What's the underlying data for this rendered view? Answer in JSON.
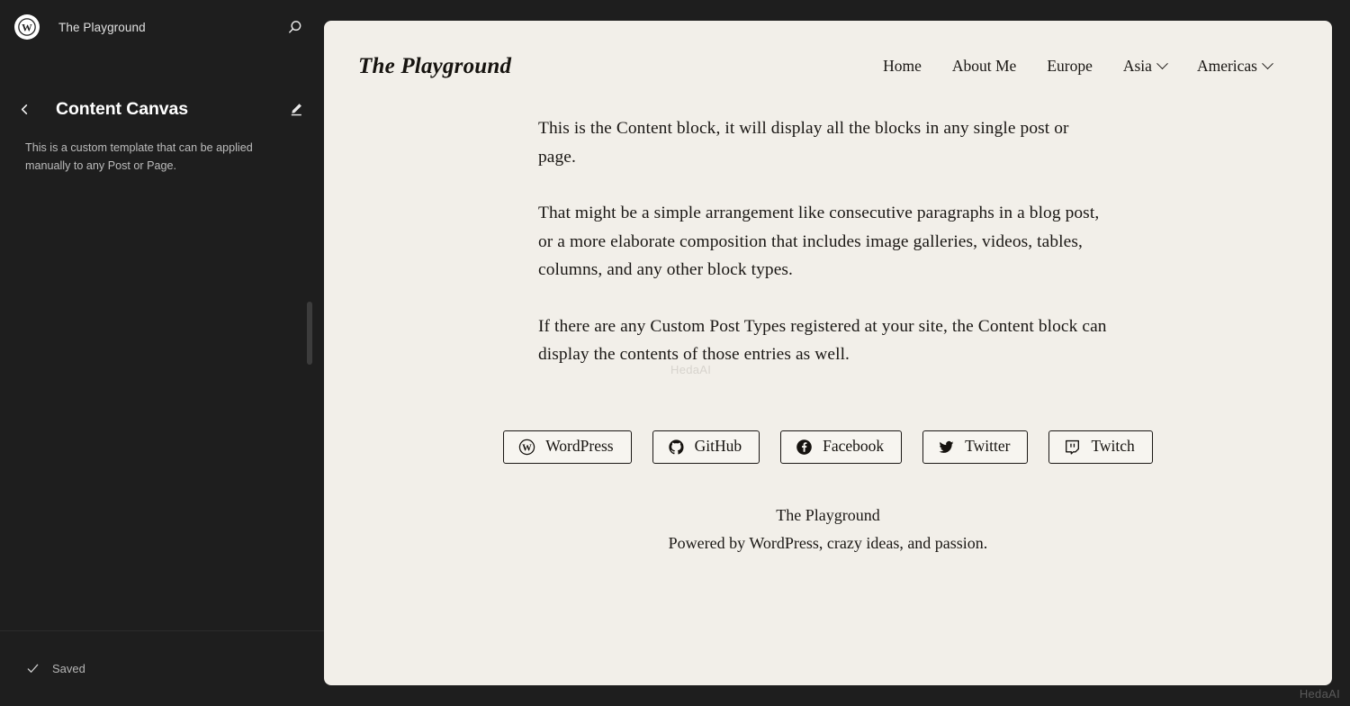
{
  "sidebar": {
    "logo_icon": "wordpress-logo-icon",
    "site_name": "The Playground",
    "search_icon": "search-icon",
    "back_icon": "chevron-left-icon",
    "template_title": "Content Canvas",
    "edit_icon": "pencil-icon",
    "template_description": "This is a custom template that can be applied manually to any Post or Page.",
    "footer": {
      "check_icon": "check-icon",
      "status": "Saved"
    }
  },
  "canvas": {
    "resize_handle": "canvas-resize-handle",
    "site_title": "The Playground",
    "nav": [
      {
        "label": "Home",
        "has_submenu": false
      },
      {
        "label": "About Me",
        "has_submenu": false
      },
      {
        "label": "Europe",
        "has_submenu": false
      },
      {
        "label": "Asia",
        "has_submenu": true
      },
      {
        "label": "Americas",
        "has_submenu": true
      }
    ],
    "paragraphs": [
      "This is the Content block, it will display all the blocks in any single post or page.",
      "That might be a simple arrangement like consecutive paragraphs in a blog post, or a more elaborate composition that includes image galleries, videos, tables, columns, and any other block types.",
      "If there are any Custom Post Types registered at your site, the Content block can display the contents of those entries as well."
    ],
    "social_buttons": [
      {
        "label": "WordPress",
        "icon": "wordpress-icon"
      },
      {
        "label": "GitHub",
        "icon": "github-icon"
      },
      {
        "label": "Facebook",
        "icon": "facebook-icon"
      },
      {
        "label": "Twitter",
        "icon": "twitter-icon"
      },
      {
        "label": "Twitch",
        "icon": "twitch-icon"
      }
    ],
    "footer": {
      "line1": "The Playground",
      "line2": "Powered by WordPress, crazy ideas, and passion."
    }
  },
  "watermark": {
    "canvas_text": "HedaAI",
    "corner_text": "HedaAI"
  },
  "colors": {
    "sidebar_bg": "#1e1e1e",
    "canvas_bg": "#f2efe9",
    "text_dark": "#1a1714",
    "sidebar_text": "#e0e0e0"
  }
}
